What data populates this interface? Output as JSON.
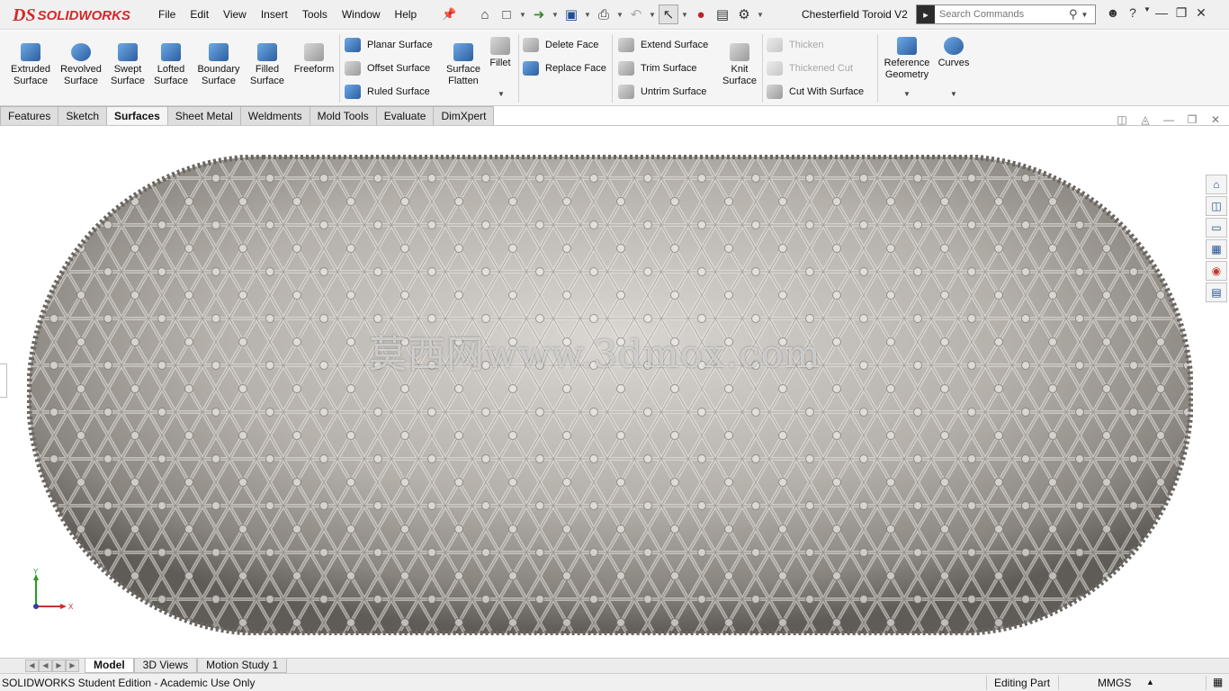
{
  "app": {
    "logo_ds": "DS",
    "logo_text": "SOLIDWORKS",
    "menu": [
      "File",
      "Edit",
      "View",
      "Insert",
      "Tools",
      "Window",
      "Help"
    ],
    "document_title": "Chesterfield Toroid V2",
    "search_placeholder": "Search Commands"
  },
  "icons": {
    "pin": "pin-icon",
    "home": "home-icon",
    "new": "new-document-icon",
    "open": "open-icon",
    "save": "save-icon",
    "print": "print-icon",
    "undo": "undo-icon",
    "select": "select-arrow-icon",
    "rebuild": "rebuild-traffic-light-icon",
    "file_properties": "file-properties-icon",
    "options": "gear-icon",
    "user": "user-icon",
    "help": "help-icon"
  },
  "ribbon": {
    "large": [
      {
        "id": "extruded-surface",
        "line1": "Extruded",
        "line2": "Surface"
      },
      {
        "id": "revolved-surface",
        "line1": "Revolved",
        "line2": "Surface"
      },
      {
        "id": "swept-surface",
        "line1": "Swept",
        "line2": "Surface"
      },
      {
        "id": "lofted-surface",
        "line1": "Lofted",
        "line2": "Surface"
      },
      {
        "id": "boundary-surface",
        "line1": "Boundary",
        "line2": "Surface"
      },
      {
        "id": "filled-surface",
        "line1": "Filled",
        "line2": "Surface"
      },
      {
        "id": "freeform",
        "line1": "Freeform",
        "line2": ""
      }
    ],
    "group_planar": [
      "Planar Surface",
      "Offset Surface",
      "Ruled Surface"
    ],
    "surface_flatten": {
      "line1": "Surface",
      "line2": "Flatten"
    },
    "fillet": "Fillet",
    "group_face": [
      "Delete Face",
      "Replace Face"
    ],
    "group_extend": [
      "Extend Surface",
      "Trim Surface",
      "Untrim Surface"
    ],
    "knit_surface": {
      "line1": "Knit",
      "line2": "Surface"
    },
    "group_thicken": [
      "Thicken",
      "Thickened Cut",
      "Cut With Surface"
    ],
    "reference_geometry": {
      "line1": "Reference",
      "line2": "Geometry"
    },
    "curves": "Curves"
  },
  "tabs": [
    "Features",
    "Sketch",
    "Surfaces",
    "Sheet Metal",
    "Weldments",
    "Mold Tools",
    "Evaluate",
    "DimXpert"
  ],
  "active_tab": "Surfaces",
  "viewport": {
    "watermark": "莫西网www.3dmox.com",
    "triad": {
      "x_label": "X",
      "y_label": "Y"
    }
  },
  "bottom_tabs": [
    "Model",
    "3D Views",
    "Motion Study 1"
  ],
  "active_bottom_tab": "Model",
  "status": {
    "edition": "SOLIDWORKS Student Edition - Academic Use Only",
    "mode": "Editing Part",
    "units": "MMGS"
  }
}
